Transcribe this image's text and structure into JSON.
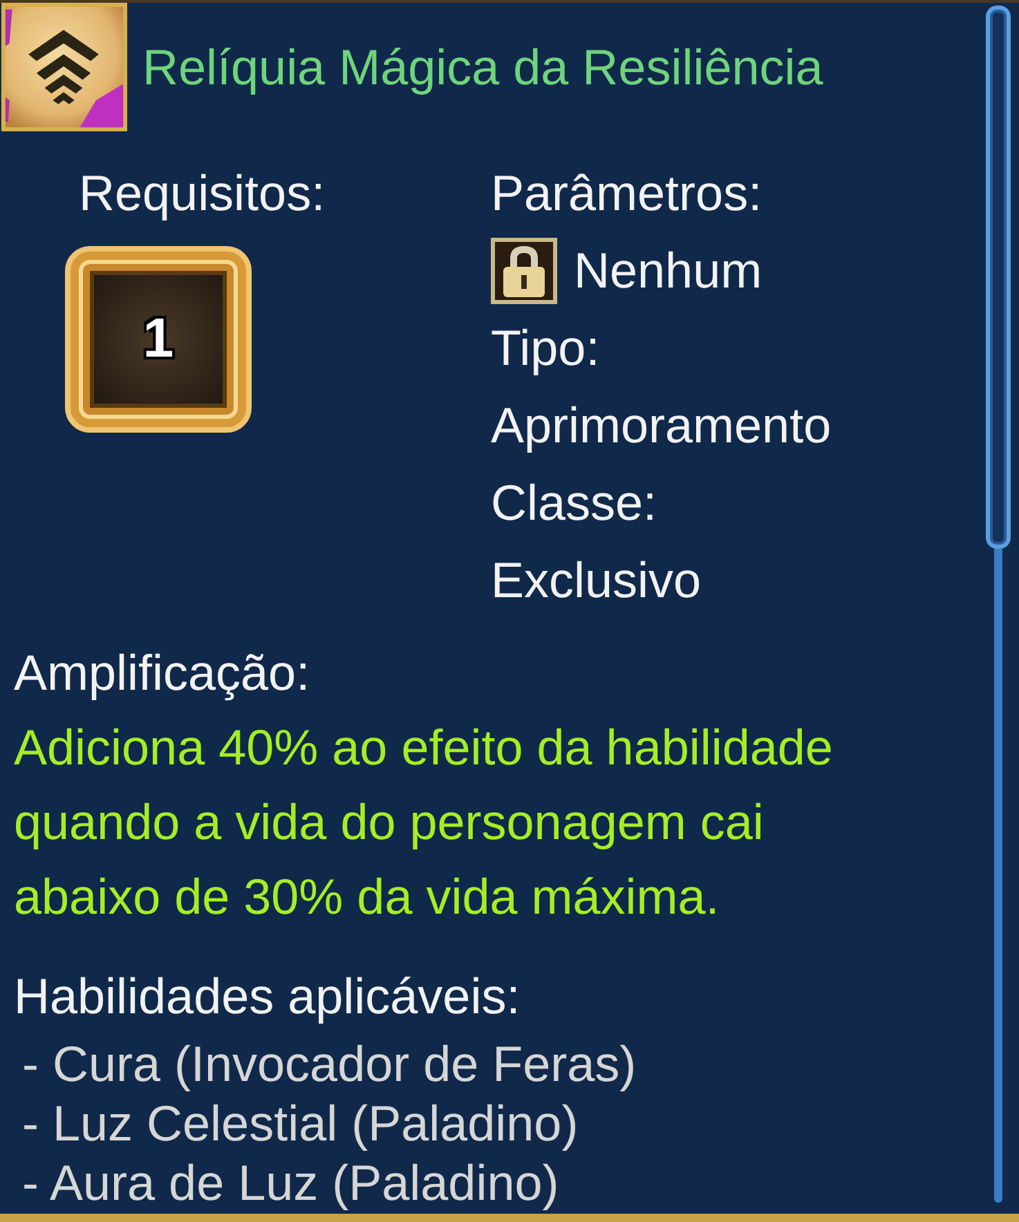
{
  "item": {
    "title": "Relíquia Mágica da Resiliência"
  },
  "requirements": {
    "label": "Requisitos:",
    "value": "1"
  },
  "parameters": {
    "label": "Parâmetros:",
    "value": "Nenhum",
    "locked": true
  },
  "type": {
    "label": "Tipo:",
    "value": "Aprimoramento"
  },
  "class": {
    "label": "Classe:",
    "value": "Exclusivo"
  },
  "amplification": {
    "label": "Amplificação:",
    "text": "Adiciona 40% ao efeito da habilidade quando a vida do personagem cai abaixo de 30% da vida máxima."
  },
  "skills": {
    "label": "Habilidades aplicáveis:",
    "items": [
      "- Cura (Invocador de Feras)",
      "- Luz Celestial (Paladino)",
      "- Aura de Luz (Paladino)"
    ]
  }
}
